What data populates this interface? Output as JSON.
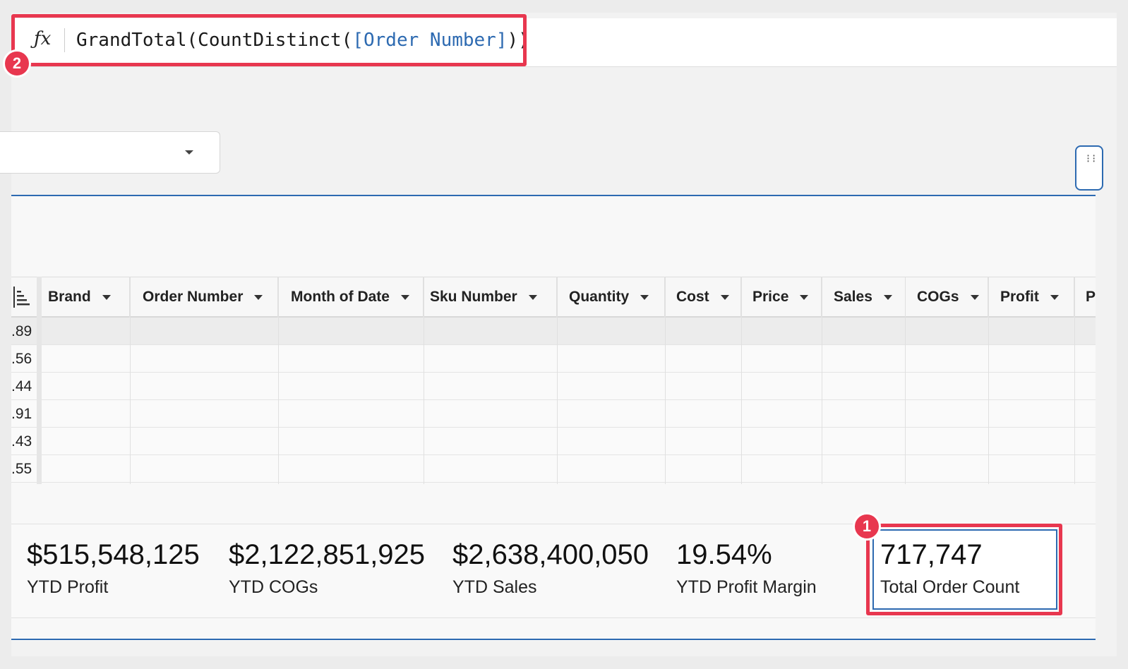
{
  "formula": {
    "fx_icon": "ƒx",
    "prefix": "GrandTotal(CountDistinct(",
    "ref": "[Order Number]",
    "suffix": "))"
  },
  "annotations": {
    "badge_1": "1",
    "badge_2": "2"
  },
  "table": {
    "columns": [
      "Brand",
      "Order Number",
      "Month of Date",
      "Sku Number",
      "Quantity",
      "Cost",
      "Price",
      "Sales",
      "COGs",
      "Profit",
      "P"
    ],
    "row_values": [
      ".89",
      ".56",
      ".44",
      ".91",
      ".43",
      ".55"
    ]
  },
  "kpis": [
    {
      "value": "$515,548,125",
      "label": "YTD Profit"
    },
    {
      "value": "$2,122,851,925",
      "label": "YTD COGs"
    },
    {
      "value": "$2,638,400,050",
      "label": "YTD Sales"
    },
    {
      "value": "19.54%",
      "label": "YTD Profit Margin"
    },
    {
      "value": "717,747",
      "label": "Total Order Count"
    }
  ],
  "colors": {
    "accent": "#2d6ab1",
    "highlight": "#e8374f"
  },
  "icons": [
    "function-icon",
    "dropdown-caret-icon",
    "drag-handle-icon",
    "column-layout-icon"
  ]
}
